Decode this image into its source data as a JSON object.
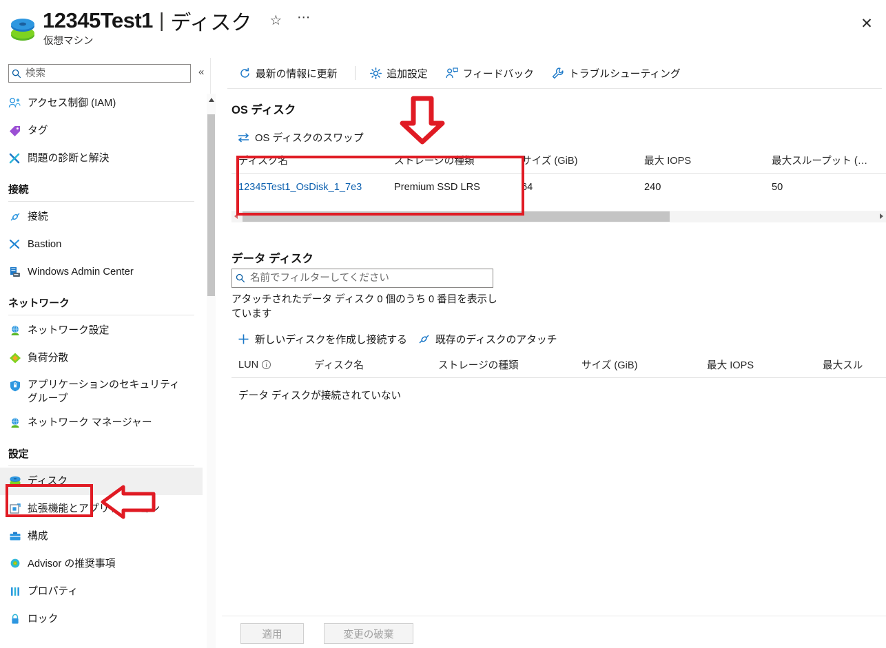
{
  "header": {
    "resource_icon": "disk-icon",
    "title": "12345Test1",
    "separator": "|",
    "page": "ディスク",
    "subtitle": "仮想マシン",
    "favorite_icon": "star-icon",
    "more_icon": "ellipsis-icon",
    "close_icon": "close-icon"
  },
  "sidebar": {
    "search": {
      "placeholder": "検索",
      "value": "",
      "icon": "search-icon"
    },
    "collapse_icon": "chevron-double-left-icon",
    "items": [
      {
        "type": "item",
        "label": "アクセス制御 (IAM)",
        "icon": "access-control-icon",
        "selected": false
      },
      {
        "type": "item",
        "label": "タグ",
        "icon": "tag-icon",
        "selected": false
      },
      {
        "type": "item",
        "label": "問題の診断と解決",
        "icon": "diagnose-icon",
        "selected": false
      },
      {
        "type": "group",
        "label": "接続"
      },
      {
        "type": "item",
        "label": "接続",
        "icon": "connect-icon",
        "selected": false
      },
      {
        "type": "item",
        "label": "Bastion",
        "icon": "bastion-icon",
        "selected": false
      },
      {
        "type": "item",
        "label": "Windows Admin Center",
        "icon": "windows-admin-center-icon",
        "selected": false
      },
      {
        "type": "group",
        "label": "ネットワーク"
      },
      {
        "type": "item",
        "label": "ネットワーク設定",
        "icon": "network-settings-icon",
        "selected": false
      },
      {
        "type": "item",
        "label": "負荷分散",
        "icon": "load-balancing-icon",
        "selected": false
      },
      {
        "type": "item",
        "label": "アプリケーションのセキュリティ グループ",
        "icon": "app-security-group-icon",
        "selected": false,
        "two_line": true
      },
      {
        "type": "item",
        "label": "ネットワーク マネージャー",
        "icon": "network-manager-icon",
        "selected": false
      },
      {
        "type": "group",
        "label": "設定"
      },
      {
        "type": "item",
        "label": "ディスク",
        "icon": "disk-icon",
        "selected": true
      },
      {
        "type": "item",
        "label": "拡張機能とアプリケーション",
        "icon": "extensions-icon",
        "selected": false
      },
      {
        "type": "item",
        "label": "構成",
        "icon": "configuration-icon",
        "selected": false
      },
      {
        "type": "item",
        "label": "Advisor の推奨事項",
        "icon": "advisor-icon",
        "selected": false
      },
      {
        "type": "item",
        "label": "プロパティ",
        "icon": "properties-icon",
        "selected": false
      },
      {
        "type": "item",
        "label": "ロック",
        "icon": "lock-icon",
        "selected": false
      }
    ]
  },
  "toolbar": {
    "commands": [
      {
        "label": "最新の情報に更新",
        "icon": "refresh-icon"
      },
      {
        "label": "追加設定",
        "icon": "gear-icon"
      },
      {
        "label": "フィードバック",
        "icon": "feedback-icon"
      },
      {
        "label": "トラブルシューティング",
        "icon": "wrench-icon"
      }
    ]
  },
  "os_disk": {
    "section_title": "OS ディスク",
    "swap_action": {
      "label": "OS ディスクのスワップ",
      "icon": "swap-icon"
    },
    "columns": [
      "ディスク名",
      "ストレージの種類",
      "サイズ (GiB)",
      "最大 IOPS",
      "最大スループット (…"
    ],
    "rows": [
      {
        "disk_name": "12345Test1_OsDisk_1_7e3",
        "storage_type": "Premium SSD LRS",
        "size_gib": "64",
        "max_iops": "240",
        "max_throughput": "50"
      }
    ]
  },
  "data_disk": {
    "section_title": "データ ディスク",
    "filter": {
      "placeholder": "名前でフィルターしてください",
      "value": "",
      "icon": "search-icon"
    },
    "count_text": "アタッチされたデータ ディスク 0 個のうち 0 番目を表示しています",
    "actions": [
      {
        "label": "新しいディスクを作成し接続する",
        "icon": "plus-icon"
      },
      {
        "label": "既存のディスクのアタッチ",
        "icon": "attach-icon"
      }
    ],
    "columns": [
      "LUN",
      "ディスク名",
      "ストレージの種類",
      "サイズ (GiB)",
      "最大 IOPS",
      "最大スル"
    ],
    "lun_info_icon": "info-icon",
    "empty_message": "データ ディスクが接続されていない"
  },
  "footer": {
    "apply_label": "適用",
    "discard_label": "変更の破棄"
  },
  "annotations": {
    "accent_color": "#e01b24",
    "down_arrow_icon": "red-down-arrow-annotation",
    "left_arrow_icon": "red-left-arrow-annotation",
    "box_os_disk_table": "red-highlight-box",
    "box_sidebar_disks": "red-highlight-box"
  }
}
